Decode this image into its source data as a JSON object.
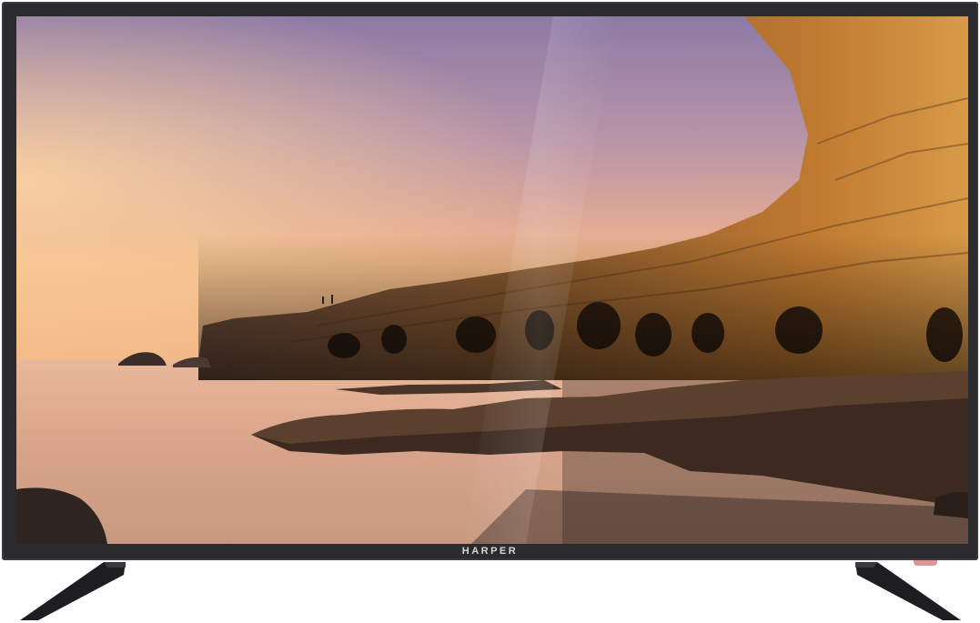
{
  "tv": {
    "brand_logo": "HARPER"
  },
  "colors": {
    "bezel": "#2b2b2e",
    "sky_top": "#8e7ba3",
    "sky_horizon": "#f0b87a",
    "cliff": "#b9762f",
    "water": "#d7a684"
  }
}
